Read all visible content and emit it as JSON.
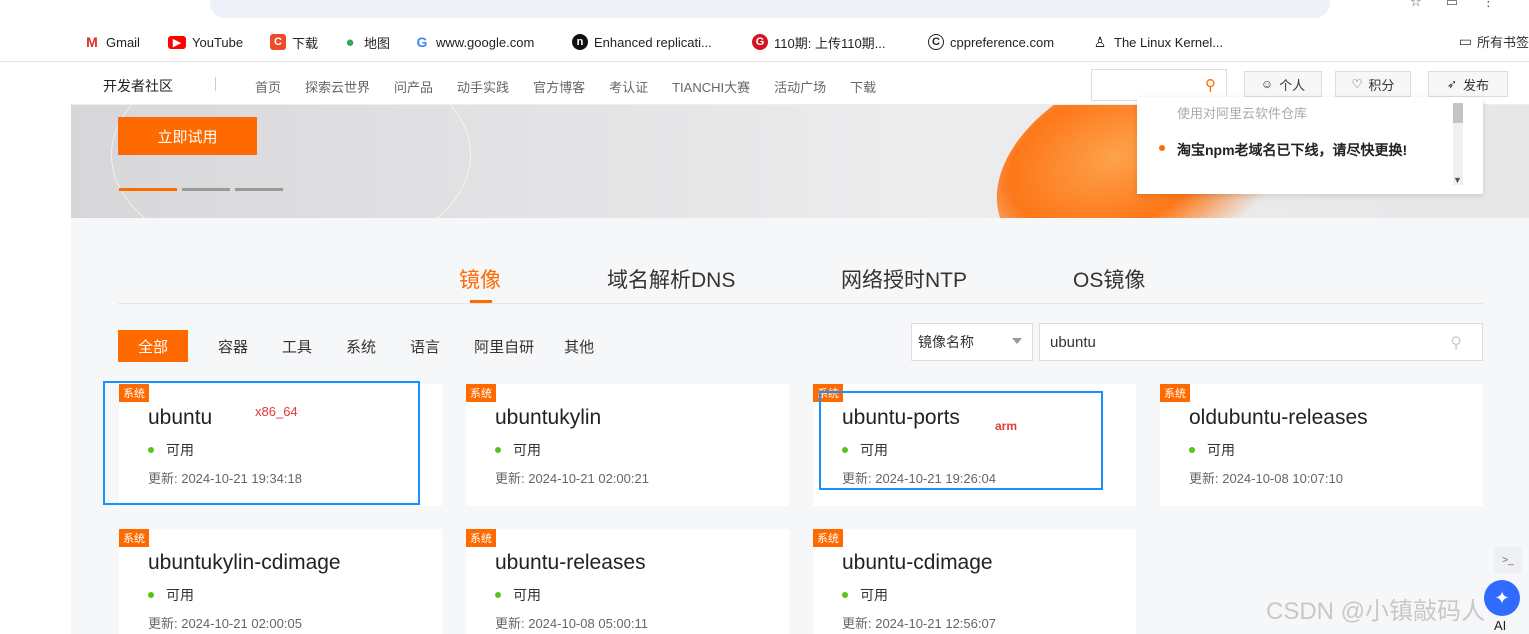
{
  "browser": {
    "bookmarks": [
      {
        "label": "Gmail",
        "icon": "gmail-icon",
        "color": "#d93025"
      },
      {
        "label": "YouTube",
        "icon": "youtube-icon",
        "color": "#ff0000"
      },
      {
        "label": "下载",
        "icon": "download-icon",
        "color": "#ee4b2b"
      },
      {
        "label": "地图",
        "icon": "maps-icon",
        "color": "#34a853"
      },
      {
        "label": "www.google.com",
        "icon": "google-icon",
        "color": "#4285f4"
      },
      {
        "label": "Enhanced replicati...",
        "icon": "site-icon",
        "color": "#111111"
      },
      {
        "label": "110期: 上传110期...",
        "icon": "site-icon",
        "color": "#d4141e"
      },
      {
        "label": "cppreference.com",
        "icon": "cpp-icon",
        "color": "#222222"
      },
      {
        "label": "The Linux Kernel...",
        "icon": "tux-icon",
        "color": "#000000"
      }
    ],
    "all_bookmarks": "所有书签"
  },
  "header": {
    "brand": "开发者社区",
    "nav": [
      "首页",
      "探索云世界",
      "问产品",
      "动手实践",
      "官方博客",
      "考认证",
      "TIANCHI大赛",
      "活动广场",
      "下载"
    ],
    "personal": "个人",
    "points": "积分",
    "publish": "发布"
  },
  "banner": {
    "try_button": "立即试用",
    "news_faded": "使用对阿里云软件仓库",
    "news_item": "淘宝npm老域名已下线，请尽快更换!"
  },
  "tabs": [
    {
      "label": "镜像",
      "active": true
    },
    {
      "label": "域名解析DNS",
      "active": false
    },
    {
      "label": "网络授时NTP",
      "active": false
    },
    {
      "label": "OS镜像",
      "active": false
    }
  ],
  "categories": [
    {
      "label": "全部",
      "active": true
    },
    {
      "label": "容器"
    },
    {
      "label": "工具"
    },
    {
      "label": "系统"
    },
    {
      "label": "语言"
    },
    {
      "label": "阿里自研"
    },
    {
      "label": "其他"
    }
  ],
  "filter": {
    "select_value": "镜像名称",
    "search_value": "ubuntu"
  },
  "cards": [
    {
      "badge": "系统",
      "name": "ubuntu",
      "status": "可用",
      "updated": "更新: 2024-10-21 19:34:18"
    },
    {
      "badge": "系统",
      "name": "ubuntukylin",
      "status": "可用",
      "updated": "更新: 2024-10-21 02:00:21"
    },
    {
      "badge": "系统",
      "name": "ubuntu-ports",
      "status": "可用",
      "updated": "更新: 2024-10-21 19:26:04"
    },
    {
      "badge": "系统",
      "name": "oldubuntu-releases",
      "status": "可用",
      "updated": "更新: 2024-10-08 10:07:10"
    },
    {
      "badge": "系统",
      "name": "ubuntukylin-cdimage",
      "status": "可用",
      "updated": "更新: 2024-10-21 02:00:05"
    },
    {
      "badge": "系统",
      "name": "ubuntu-releases",
      "status": "可用",
      "updated": "更新: 2024-10-08 05:00:11"
    },
    {
      "badge": "系统",
      "name": "ubuntu-cdimage",
      "status": "可用",
      "updated": "更新: 2024-10-21 12:56:07"
    }
  ],
  "annotations": {
    "x86": "x86_64",
    "arm": "arm"
  },
  "watermark": "CSDN @小镇敲码人",
  "ai_label": "AI",
  "colors": {
    "accent": "#ff6a00",
    "status": "#52c41a",
    "annotation_box": "#1890ff",
    "annotation_text": "#e23a3a"
  }
}
